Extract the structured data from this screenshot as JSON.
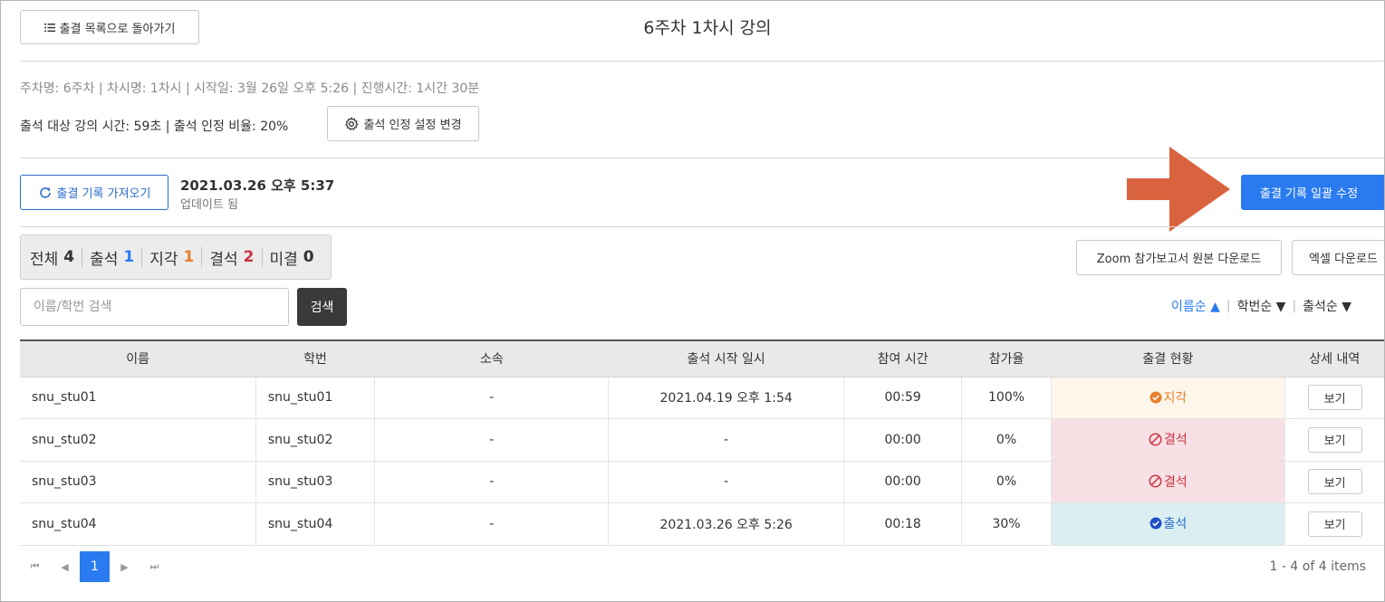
{
  "header": {
    "back_label": "출결 목록으로 돌아가기",
    "title": "6주차 1차시 강의"
  },
  "info": {
    "line1": "주차명: 6주차 | 차시명: 1차시 | 시작일: 3월 26일 오후 5:26 | 진행시간: 1시간 30분",
    "line2": "출석 대상 강의 시간: 59초 | 출석 인정 비율: 20%",
    "setting_label": "출석 인정 설정 변경"
  },
  "sync": {
    "fetch_label": "출결 기록 가져오기",
    "updated_time": "2021.03.26 오후 5:37",
    "updated_status": "업데이트 됨",
    "bulk_edit_label": "출결 기록 일괄 수정"
  },
  "stats": [
    {
      "label": "전체",
      "count": "4",
      "color": "#333333"
    },
    {
      "label": "출석",
      "count": "1",
      "color": "#2a7bf0"
    },
    {
      "label": "지각",
      "count": "1",
      "color": "#e87e2b"
    },
    {
      "label": "결석",
      "count": "2",
      "color": "#cc3344"
    },
    {
      "label": "미결",
      "count": "0",
      "color": "#333333"
    }
  ],
  "downloads": {
    "zoom_label": "Zoom 참가보고서 원본 다운로드",
    "excel_label": "엑셀 다운로드"
  },
  "search": {
    "placeholder": "이름/학번 검색",
    "value": "",
    "button_label": "검색"
  },
  "sort": {
    "name": "이름순 ▲",
    "id": "학번순 ▼",
    "attendance": "출석순 ▼"
  },
  "table": {
    "columns": [
      "이름",
      "학번",
      "소속",
      "출석 시작 일시",
      "참여 시간",
      "참가율",
      "출결 현황",
      "상세 내역"
    ],
    "rows": [
      {
        "name": "snu_stu01",
        "id": "snu_stu01",
        "dept": "-",
        "start": "2021.04.19 오후 1:54",
        "duration": "00:59",
        "rate": "100%",
        "status": "지각",
        "status_type": "late",
        "detail": "보기"
      },
      {
        "name": "snu_stu02",
        "id": "snu_stu02",
        "dept": "-",
        "start": "-",
        "duration": "00:00",
        "rate": "0%",
        "status": "결석",
        "status_type": "absent",
        "detail": "보기"
      },
      {
        "name": "snu_stu03",
        "id": "snu_stu03",
        "dept": "-",
        "start": "-",
        "duration": "00:00",
        "rate": "0%",
        "status": "결석",
        "status_type": "absent",
        "detail": "보기"
      },
      {
        "name": "snu_stu04",
        "id": "snu_stu04",
        "dept": "-",
        "start": "2021.03.26 오후 5:26",
        "duration": "00:18",
        "rate": "30%",
        "status": "출석",
        "status_type": "present",
        "detail": "보기"
      }
    ]
  },
  "pagination": {
    "current_page": "1",
    "summary": "1 - 4 of 4 items"
  },
  "colors": {
    "accent": "#2a7bf0",
    "annotation_arrow": "#d9633f"
  }
}
